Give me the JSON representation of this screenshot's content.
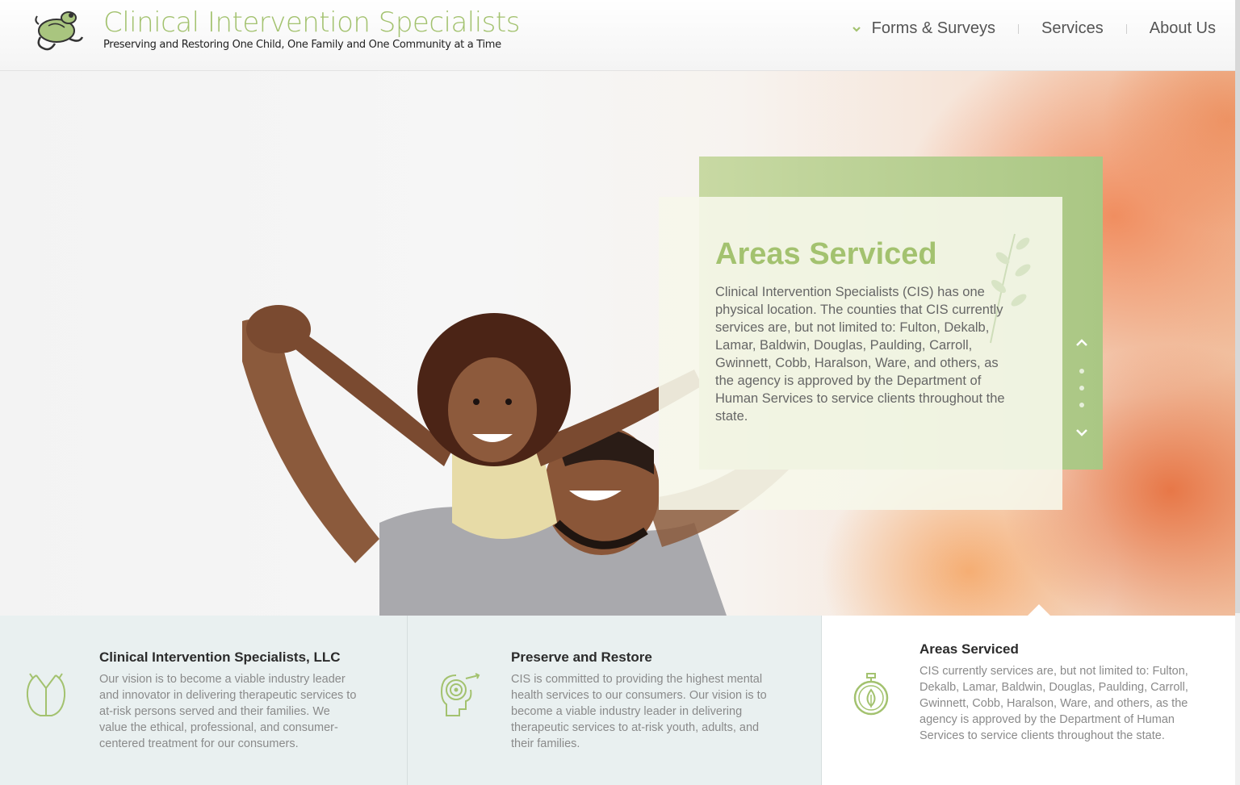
{
  "brand": {
    "title": "Clinical Intervention Specialists",
    "tagline": "Preserving and Restoring One Child, One Family and One Community at a Time",
    "logo_icon": "frog-icon",
    "accent_color": "#a3c26f"
  },
  "nav": {
    "items": [
      {
        "label": "Forms & Surveys",
        "icon": "chevron-down-icon"
      },
      {
        "label": "Services"
      },
      {
        "label": "About Us"
      }
    ]
  },
  "hero": {
    "image": "father-and-daughter-photo",
    "card": {
      "title": "Areas Serviced",
      "text": "Clinical Intervention Specialists (CIS) has one physical location.  The counties that CIS currently services are, but not limited to: Fulton, Dekalb, Lamar, Baldwin, Douglas, Paulding, Carroll, Gwinnett, Cobb, Haralson, Ware, and others, as the agency is approved by the Department of Human Services to service clients throughout the state."
    },
    "slider": {
      "up_icon": "chevron-up-icon",
      "down_icon": "chevron-down-icon",
      "dot_count": 3
    }
  },
  "panels": [
    {
      "icon": "shirt-icon",
      "title": "Clinical Intervention Specialists, LLC",
      "text": "Our vision is to become a viable industry leader and innovator in delivering therapeutic services to at-risk persons served and their families. We value the ethical, professional, and consumer-centered treatment for our consumers."
    },
    {
      "icon": "head-spiral-icon",
      "title": "Preserve and Restore",
      "text": "CIS is committed to providing the highest mental health services to our consumers. Our vision is to become a viable industry leader in delivering therapeutic services to at-risk youth, adults, and their families."
    },
    {
      "icon": "stopwatch-leaf-icon",
      "title": "Areas Serviced",
      "text": "CIS currently services are, but not limited to: Fulton, Dekalb, Lamar, Baldwin, Douglas, Paulding, Carroll, Gwinnett, Cobb, Haralson, Ware, and others, as the agency is approved by the Department of Human Services to service clients throughout the state.",
      "active": true
    }
  ]
}
